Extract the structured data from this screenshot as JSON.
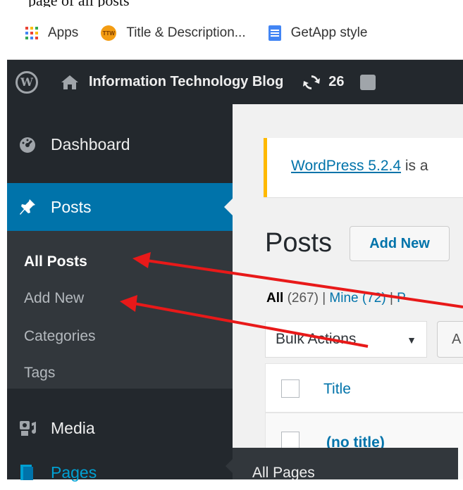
{
  "caption": "page of all posts",
  "bookmarks": {
    "items": [
      {
        "label": "Apps",
        "icon": "apps-grid-icon"
      },
      {
        "label": "Title & Description...",
        "icon": "ttw-icon",
        "badge": "TTW"
      },
      {
        "label": "GetApp style",
        "icon": "google-docs-icon"
      }
    ]
  },
  "adminbar": {
    "logo_letter": "W",
    "site_name": "Information Technology Blog",
    "updates_count": "26"
  },
  "sidebar": {
    "dashboard": "Dashboard",
    "posts": "Posts",
    "submenu": [
      "All Posts",
      "Add New",
      "Categories",
      "Tags"
    ],
    "media": "Media",
    "pages": "Pages",
    "pages_flyout": "All Pages"
  },
  "notice": {
    "link": "WordPress 5.2.4",
    "text": " is a"
  },
  "main": {
    "title": "Posts",
    "add_new": "Add New",
    "filter_all": "All",
    "filter_all_count": "(267)",
    "sep1": " | ",
    "filter_mine": "Mine (72)",
    "sep2": " | ",
    "filter_more": "P",
    "bulk_actions": "Bulk Actions",
    "bulk_caret": "▼",
    "apply": "A",
    "col_title": "Title",
    "row_title": "(no title)"
  },
  "colors": {
    "adminbar": "#23282d",
    "sidebar": "#23282d",
    "active": "#0073aa",
    "submenu": "#32373c",
    "notice_border": "#ffb900",
    "link": "#0073aa",
    "arrow": "#e81919"
  }
}
